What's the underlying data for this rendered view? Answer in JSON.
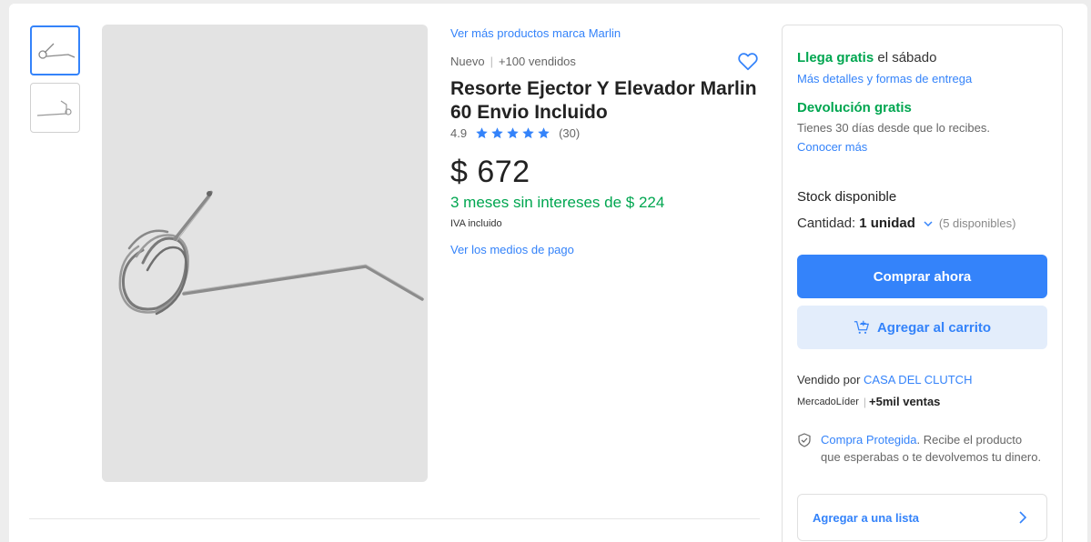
{
  "gallery": {
    "thumbnails": [
      "spring-front",
      "spring-side"
    ],
    "main_image": "spring-main"
  },
  "product": {
    "brand_link": "Ver más productos marca Marlin",
    "condition": "Nuevo",
    "separator": "|",
    "sold": "+100 vendidos",
    "title": "Resorte Ejector Y Elevador Marlin 60 Envio Incluido",
    "rating_value": "4.9",
    "stars": 5,
    "review_count": "(30)",
    "price": "$ 672",
    "installments": "3 meses sin intereses de $ 224",
    "tax_note": "IVA incluido",
    "payment_link": "Ver los medios de pago"
  },
  "buybox": {
    "shipping_free": "Llega gratis",
    "shipping_day": " el sábado",
    "shipping_link": "Más detalles y formas de entrega",
    "return_title": "Devolución gratis",
    "return_text": "Tienes 30 días desde que lo recibes.",
    "return_link": "Conocer más",
    "stock": "Stock disponible",
    "qty_label": "Cantidad:",
    "qty_value": "1 unidad",
    "qty_available": "(5 disponibles)",
    "buy_button": "Comprar ahora",
    "cart_button": "Agregar al carrito",
    "seller_prefix": "Vendido por ",
    "seller_name": "CASA DEL CLUTCH",
    "leader_badge": "MercadoLíder",
    "leader_sales": "+5mil ventas",
    "protect_link": "Compra Protegida",
    "protect_text": ". Recibe el producto que esperabas o te devolvemos tu dinero.",
    "list_button": "Agregar a una lista"
  },
  "colors": {
    "accent": "#3483fa",
    "green": "#00a650",
    "cart_bg": "#e3edfb",
    "background": "#ededed"
  },
  "icons": [
    "heart-icon",
    "star-icon",
    "chevron-down-icon",
    "cart-add-icon",
    "shield-check-icon",
    "chevron-right-icon"
  ]
}
